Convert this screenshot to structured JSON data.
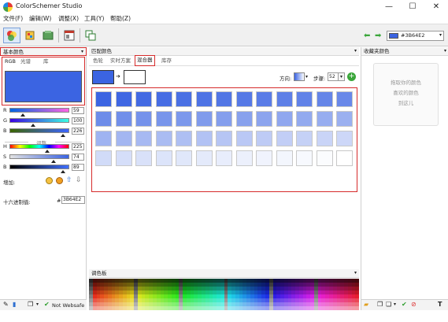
{
  "title": "ColorSchemer Studio",
  "window_controls": [
    "—",
    "☐",
    "✕"
  ],
  "menu": [
    "文件(F)",
    "编辑(W)",
    "调整(X)",
    "工具(Y)",
    "帮助(Z)"
  ],
  "current_color_hex": "#3B64E2",
  "base_color_panel": {
    "title": "基本颜色",
    "tabs": [
      "RGB",
      "光谱",
      "库"
    ],
    "swatch_color": "#3b64e2",
    "rgb": [
      {
        "label": "R",
        "value": "59",
        "fraction": 0.23
      },
      {
        "label": "G",
        "value": "100",
        "fraction": 0.39
      },
      {
        "label": "B",
        "value": "226",
        "fraction": 0.89
      }
    ],
    "adjust_label": "调整",
    "hsb": [
      {
        "label": "H",
        "value": "225",
        "fraction": 0.625
      },
      {
        "label": "S",
        "value": "74",
        "fraction": 0.74
      },
      {
        "label": "B",
        "value": "89",
        "fraction": 0.89
      }
    ],
    "increase_label": "增加:",
    "hex_label": "十六进制值:",
    "hex_hash": "#",
    "hex_value": "3B64E2",
    "websafe_label": "Not Websafe"
  },
  "match_panel": {
    "title": "匹配颜色",
    "tabs": [
      "色轮",
      "实时方案",
      "混合器",
      "库存"
    ],
    "active_tab": "混合器",
    "start_color": "#3b64e2",
    "end_color": "#ffffff",
    "direction_label": "方向:",
    "steps_label": "步骤:",
    "steps_value": "52",
    "blend_steps": 52
  },
  "palette_panel": {
    "title": "调色板"
  },
  "favorites_panel": {
    "title": "收藏夹颜色",
    "hint_lines": [
      "拖取你的颜色",
      "喜欢的颜色",
      "到这儿"
    ]
  },
  "colors": {
    "accent_red": "#d62b2b",
    "nav_green": "#3aa63a"
  }
}
